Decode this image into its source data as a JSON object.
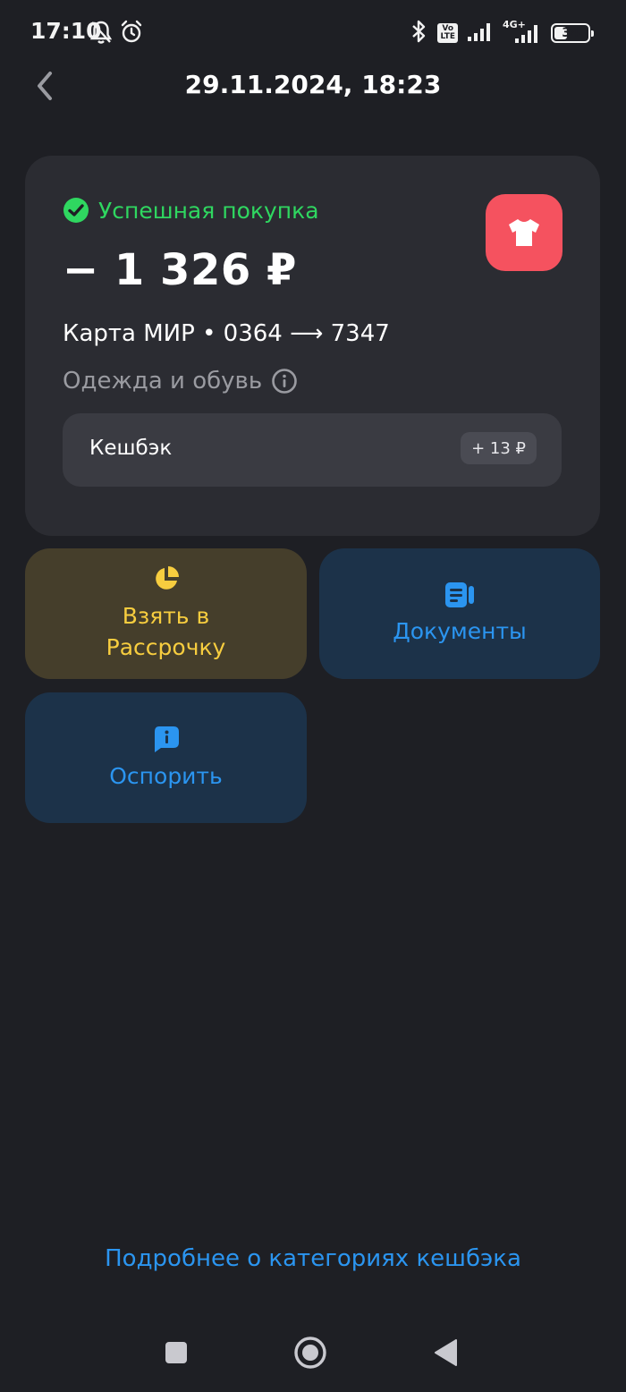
{
  "status_bar": {
    "time": "17:10",
    "icons": [
      "bell-muted-icon",
      "alarm-icon",
      "bluetooth-icon",
      "volte-icon",
      "signal-icon",
      "network-4g-icon",
      "battery-icon"
    ],
    "volte_label": "Vo\nLTE",
    "network_label": "4G+",
    "battery_level": "34"
  },
  "header": {
    "title": "29.11.2024, 18:23",
    "back_icon": "chevron-left-icon"
  },
  "transaction": {
    "status": "Успешная покупка",
    "status_icon": "check-circle-icon",
    "amount": "− 1 326 ₽",
    "category_icon": "tshirt-icon",
    "card_route": "Карта МИР • 0364 ⟶ 7347",
    "category": "Одежда и обувь",
    "info_icon": "info-icon",
    "cashback_label": "Кешбэк",
    "cashback_value": "+ 13 ₽"
  },
  "actions": {
    "installment": {
      "label_line1": "Взять в",
      "label_line2": "Рассрочку",
      "icon": "pie-chart-icon"
    },
    "documents": {
      "label": "Документы",
      "icon": "document-icon"
    },
    "dispute": {
      "label": "Оспорить",
      "icon": "message-info-icon"
    }
  },
  "footer": {
    "link": "Подробнее о категориях кешбэка"
  },
  "colors": {
    "background": "#1e1f24",
    "card": "#2b2c32",
    "success": "#2fd760",
    "badge": "#f5525f",
    "yellow": "#f7cd3f",
    "blue": "#2b95f0"
  }
}
